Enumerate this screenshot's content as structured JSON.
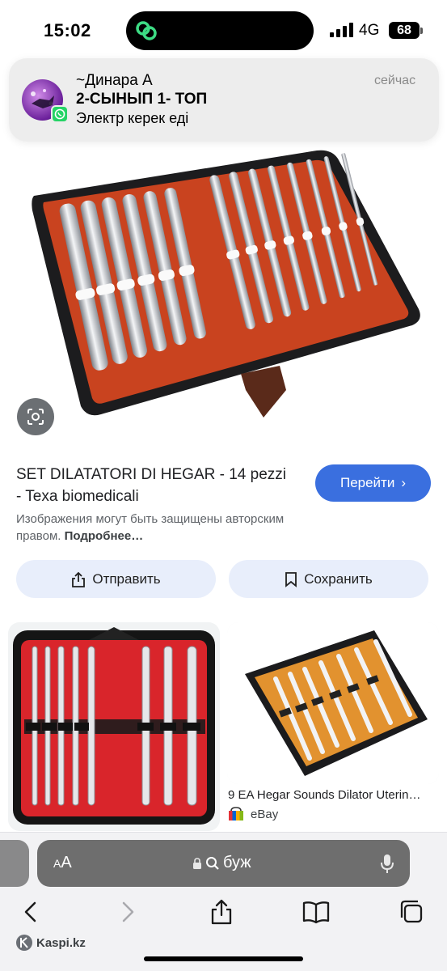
{
  "status_bar": {
    "time": "15:02",
    "network": "4G",
    "battery": "68"
  },
  "notification": {
    "sender": "~Динара А",
    "group": "2-СЫНЫП 1- ТОП",
    "message": "Электр керек еді",
    "time": "сейчас",
    "app_icon": "whatsapp-icon"
  },
  "result": {
    "title": "SET DILATATORI DI HEGAR - 14 pezzi - Texa biomedicali",
    "go_label": "Перейти",
    "copyright_text": "Изображения могут быть защищены авторским правом.",
    "copyright_more": "Подробнее…",
    "share_label": "Отправить",
    "save_label": "Сохранить"
  },
  "related": [
    {
      "title": "",
      "source": ""
    },
    {
      "title": "9 EA Hegar Sounds Dilator Uterin…",
      "source": "eBay"
    }
  ],
  "browser": {
    "aa_label": "AA",
    "url": "буж"
  },
  "watermark": "Kaspi.kz",
  "colors": {
    "accent": "#3a6fdf",
    "case_orange": "#c9431f",
    "whatsapp": "#25d366",
    "address_bar": "#6e6e6e"
  }
}
